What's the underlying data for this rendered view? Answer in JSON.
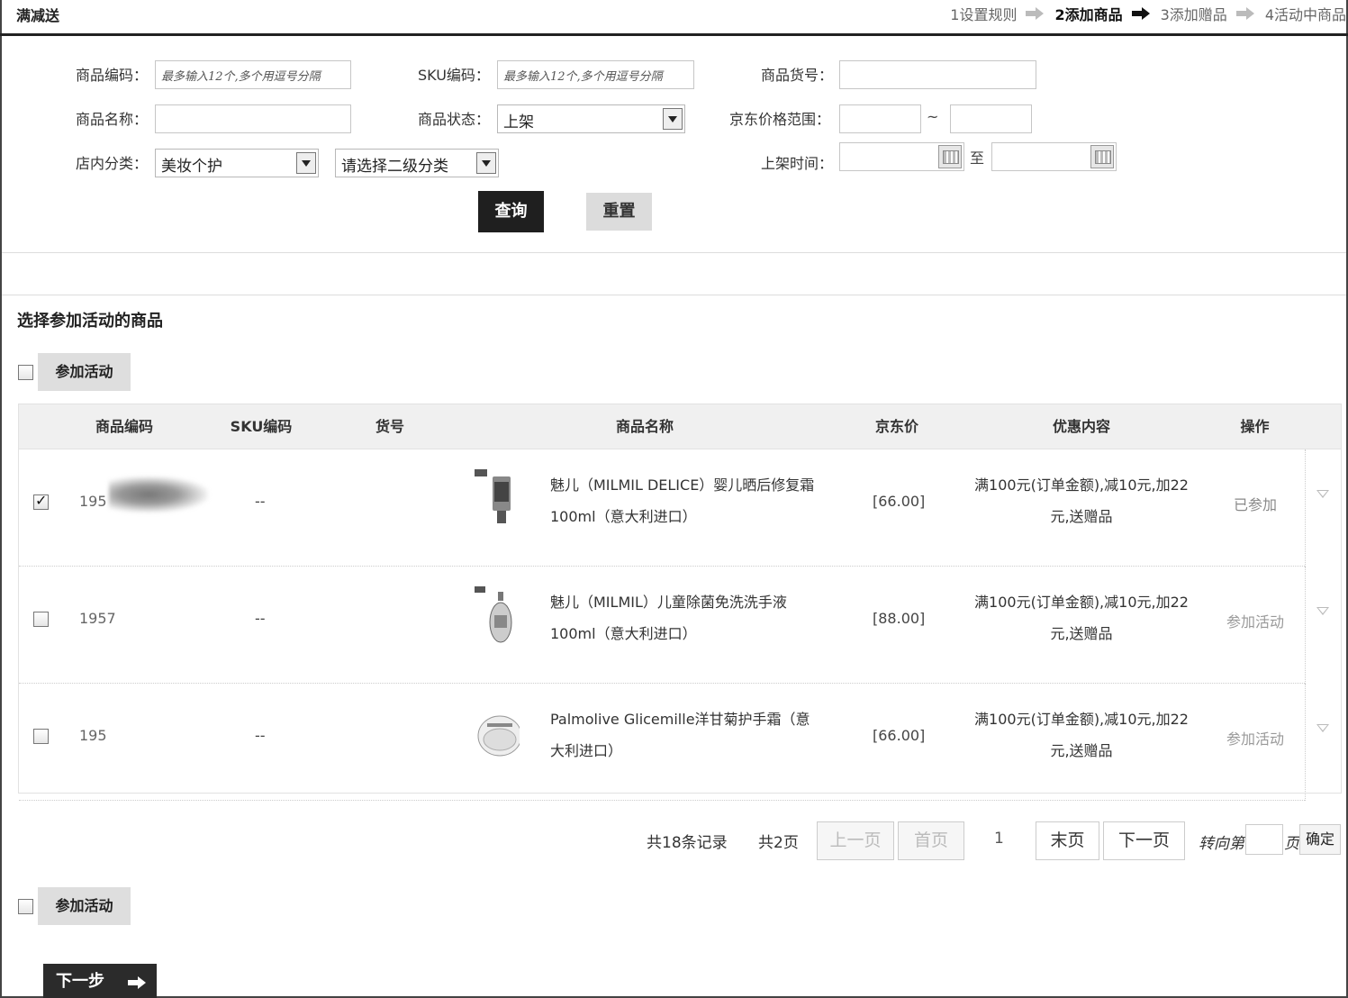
{
  "app": {
    "title": "满减送"
  },
  "steps": [
    {
      "label": "1设置规则",
      "active": false
    },
    {
      "label": "2添加商品",
      "active": true
    },
    {
      "label": "3添加赠品",
      "active": false
    },
    {
      "label": "4活动中商品",
      "active": false
    }
  ],
  "filters": {
    "product_code": {
      "label": "商品编码：",
      "placeholder": "最多输入12个,多个用逗号分隔",
      "value": ""
    },
    "sku_code": {
      "label": "SKU编码：",
      "placeholder": "最多输入12个,多个用逗号分隔",
      "value": ""
    },
    "item_number": {
      "label": "商品货号：",
      "value": ""
    },
    "product_name": {
      "label": "商品名称：",
      "value": ""
    },
    "status": {
      "label": "商品状态：",
      "selected": "上架"
    },
    "price_range": {
      "label": "京东价格范围：",
      "separator": "~",
      "from": "",
      "to": ""
    },
    "category": {
      "label": "店内分类：",
      "level1": "美妆个护",
      "level2": "请选择二级分类"
    },
    "listing_time": {
      "label": "上架时间：",
      "separator": "至",
      "from": "",
      "to": ""
    },
    "query_label": "查询",
    "reset_label": "重置"
  },
  "section": {
    "title": "选择参加活动的商品"
  },
  "join_button_label": "参加活动",
  "table": {
    "headers": [
      "商品编码",
      "SKU编码",
      "货号",
      "商品名称",
      "京东价",
      "优惠内容",
      "操作"
    ],
    "rows": [
      {
        "checked": true,
        "code": "195",
        "sku": "--",
        "item_no": "",
        "name": "魅儿（MILMIL DELICE）婴儿晒后修复霜 100ml（意大利进口）",
        "price": "[66.00]",
        "promo": "满100元(订单金额),减10元,加22元,送赠品",
        "op": "已参加"
      },
      {
        "checked": false,
        "code": "1957",
        "sku": "--",
        "item_no": "",
        "name": "魅儿（MILMIL）儿童除菌免洗洗手液100ml（意大利进口）",
        "price": "[88.00]",
        "promo": "满100元(订单金额),减10元,加22元,送赠品",
        "op": "参加活动"
      },
      {
        "checked": false,
        "code": "195",
        "sku": "--",
        "item_no": "",
        "name": "Palmolive Glicemille洋甘菊护手霜（意大利进口）",
        "price": "[66.00]",
        "promo": "满100元(订单金额),减10元,加22元,送赠品",
        "op": "参加活动"
      }
    ]
  },
  "pagination": {
    "total_records": "共18条记录",
    "total_pages": "共2页",
    "prev": "上一页",
    "first": "首页",
    "current": "1",
    "last": "末页",
    "next": "下一页",
    "goto_prefix": "转向第",
    "goto_suffix": "页",
    "goto_value": "",
    "confirm": "确定"
  },
  "next_step_label": "下一步"
}
